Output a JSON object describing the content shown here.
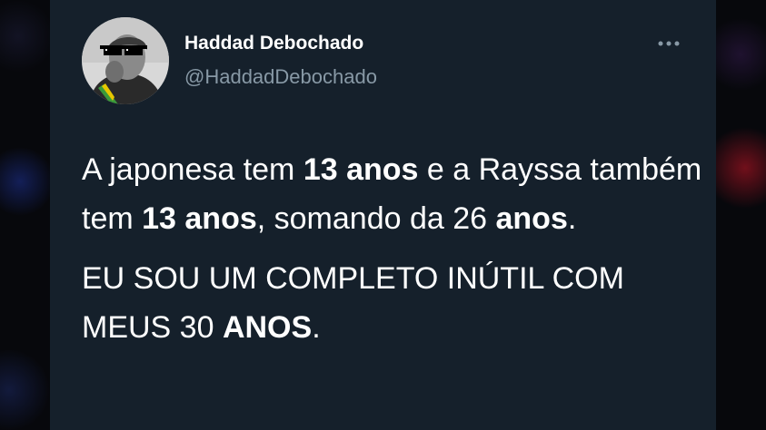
{
  "author": {
    "display_name": "Haddad Debochado",
    "handle": "@HaddadDebochado"
  },
  "tweet": {
    "p1_s1": "A japonesa tem ",
    "p1_b1": "13 anos",
    "p1_s2": " e a Rayssa também tem ",
    "p1_b2": "13 anos",
    "p1_s3": ", somando da 26 ",
    "p1_b3": "anos",
    "p1_s4": ".",
    "p2_s1": "EU SOU UM COMPLETO INÚTIL COM MEUS 30 ",
    "p2_b1": "ANOS",
    "p2_s2": "."
  },
  "icons": {
    "more": "more-horizontal-icon",
    "avatar": "profile-photo"
  },
  "colors": {
    "card_background": "#15202b",
    "primary_text": "#ffffff",
    "secondary_text": "#8899a6",
    "page_background": "#07080c"
  }
}
